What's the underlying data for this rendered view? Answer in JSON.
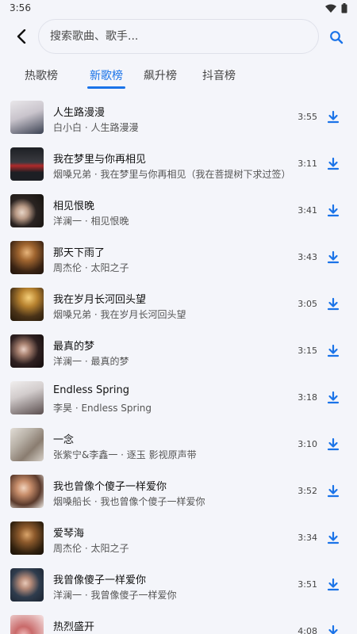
{
  "status": {
    "time": "3:56"
  },
  "search": {
    "placeholder": "搜索歌曲、歌手..."
  },
  "tabs": [
    {
      "label": "热歌榜",
      "active": false
    },
    {
      "label": "新歌榜",
      "active": true
    },
    {
      "label": "飙升榜",
      "active": false
    },
    {
      "label": "抖音榜",
      "active": false
    }
  ],
  "colors": {
    "accent": "#1a73e8",
    "background": "#f4f5fa"
  },
  "songs": [
    {
      "title": "人生路漫漫",
      "subtitle": "白小白 · 人生路漫漫",
      "duration": "3:55"
    },
    {
      "title": "我在梦里与你再相见",
      "subtitle": "烟嗓兄弟 · 我在梦里与你再相见（我在菩提树下求过签）",
      "duration": "3:11"
    },
    {
      "title": "相见恨晚",
      "subtitle": "洋澜一 · 相见恨晚",
      "duration": "3:41"
    },
    {
      "title": "那天下雨了",
      "subtitle": "周杰伦 · 太阳之子",
      "duration": "3:43"
    },
    {
      "title": "我在岁月长河回头望",
      "subtitle": "烟嗓兄弟 · 我在岁月长河回头望",
      "duration": "3:05"
    },
    {
      "title": "最真的梦",
      "subtitle": "洋澜一 · 最真的梦",
      "duration": "3:15"
    },
    {
      "title": "Endless Spring",
      "subtitle": "李昊 · Endless Spring",
      "duration": "3:18"
    },
    {
      "title": "一念",
      "subtitle": "张紫宁&李鑫一 · 逐玉 影视原声带",
      "duration": "3:10"
    },
    {
      "title": "我也曾像个傻子一样爱你",
      "subtitle": "烟嗓船长 · 我也曾像个傻子一样爱你",
      "duration": "3:52"
    },
    {
      "title": "爱琴海",
      "subtitle": "周杰伦 · 太阳之子",
      "duration": "3:34"
    },
    {
      "title": "我曾像傻子一样爱你",
      "subtitle": "洋澜一 · 我曾像傻子一样爱你",
      "duration": "3:51"
    },
    {
      "title": "热烈盛开",
      "subtitle": "",
      "duration": "4:08"
    }
  ]
}
